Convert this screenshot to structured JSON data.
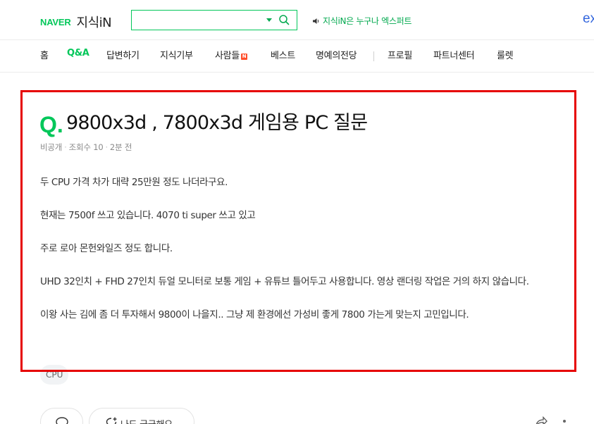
{
  "header": {
    "brand": "NAVER",
    "service": "지식iN",
    "search_value": "",
    "promo_text": "지식iN은 누구나 엑스퍼트",
    "edge_text": "ex"
  },
  "nav": {
    "items": [
      {
        "label": "홈"
      },
      {
        "label": "Q&A",
        "active": true
      },
      {
        "label": "답변하기"
      },
      {
        "label": "지식기부"
      },
      {
        "label": "사람들",
        "badge": "N"
      },
      {
        "label": "베스트"
      },
      {
        "label": "명예의전당"
      },
      {
        "label": "프로필"
      },
      {
        "label": "파트너센터"
      },
      {
        "label": "룰렛"
      }
    ]
  },
  "question": {
    "mark": "Q.",
    "title": "9800x3d , 7800x3d 게임용 PC 질문",
    "meta": {
      "author": "비공개",
      "views": "조회수 10",
      "time": "2분 전"
    },
    "body": [
      "두 CPU 가격 차가 대략 25만원 정도 나더라구요.",
      "현재는 7500f 쓰고 있습니다. 4070 ti super 쓰고 있고",
      "주로 로아 몬헌와일즈 정도 합니다.",
      "UHD 32인치 + FHD 27인치 듀얼 모니터로 보통 게임 + 유튜브 틀어두고 사용합니다. 영상 랜더링 작업은 거의 하지 않습니다.",
      "이왕 사는 김에 좀 더 투자해서 9800이 나을지.. 그냥 제 환경에선 가성비 좋게 7800 가는게 맞는지 고민입니다."
    ],
    "tag": "CPU"
  },
  "actions": {
    "curious_label": "나도 궁금해요"
  },
  "colors": {
    "brand_green": "#03c75a",
    "highlight_red": "#e60000"
  }
}
